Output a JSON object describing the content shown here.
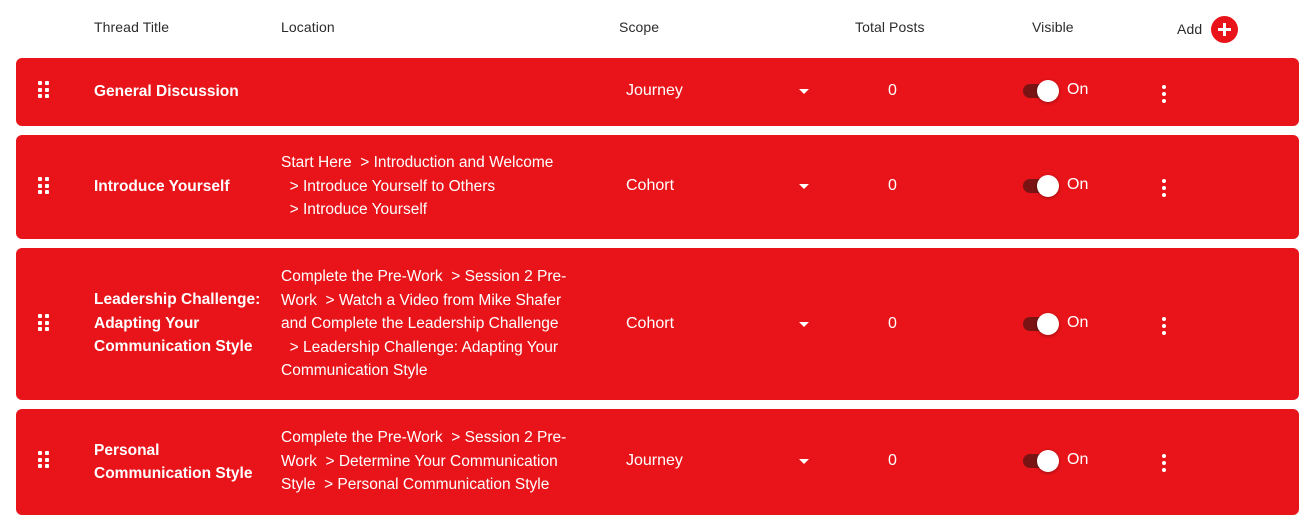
{
  "header": {
    "thread_title": "Thread Title",
    "location": "Location",
    "scope": "Scope",
    "total_posts": "Total Posts",
    "visible": "Visible",
    "add": "Add"
  },
  "colors": {
    "row_background": "#e8141a",
    "add_button": "#e8141a",
    "toggle_track": "#7a1414",
    "text_on_row": "#ffffff"
  },
  "rows": [
    {
      "title": "General Discussion",
      "location_lines": [],
      "scope": "Journey",
      "total_posts": "0",
      "visible": "On"
    },
    {
      "title": "Introduce Yourself",
      "location_lines": [
        "Start Here  > Introduction and Welcome",
        "  > Introduce Yourself to Others",
        "  > Introduce Yourself"
      ],
      "scope": "Cohort",
      "total_posts": "0",
      "visible": "On"
    },
    {
      "title": "Leadership Challenge: Adapting Your Communication Style",
      "location_lines": [
        "Complete the Pre-Work  > Session 2 Pre-",
        "Work  > Watch a Video from Mike Shafer",
        "and Complete the Leadership Challenge",
        "  > Leadership Challenge: Adapting Your",
        "Communication Style"
      ],
      "scope": "Cohort",
      "total_posts": "0",
      "visible": "On"
    },
    {
      "title": "Personal Communication Style",
      "location_lines": [
        "Complete the Pre-Work  > Session 2 Pre-",
        "Work  > Determine Your Communication",
        "Style  > Personal Communication Style"
      ],
      "scope": "Journey",
      "total_posts": "0",
      "visible": "On"
    }
  ]
}
